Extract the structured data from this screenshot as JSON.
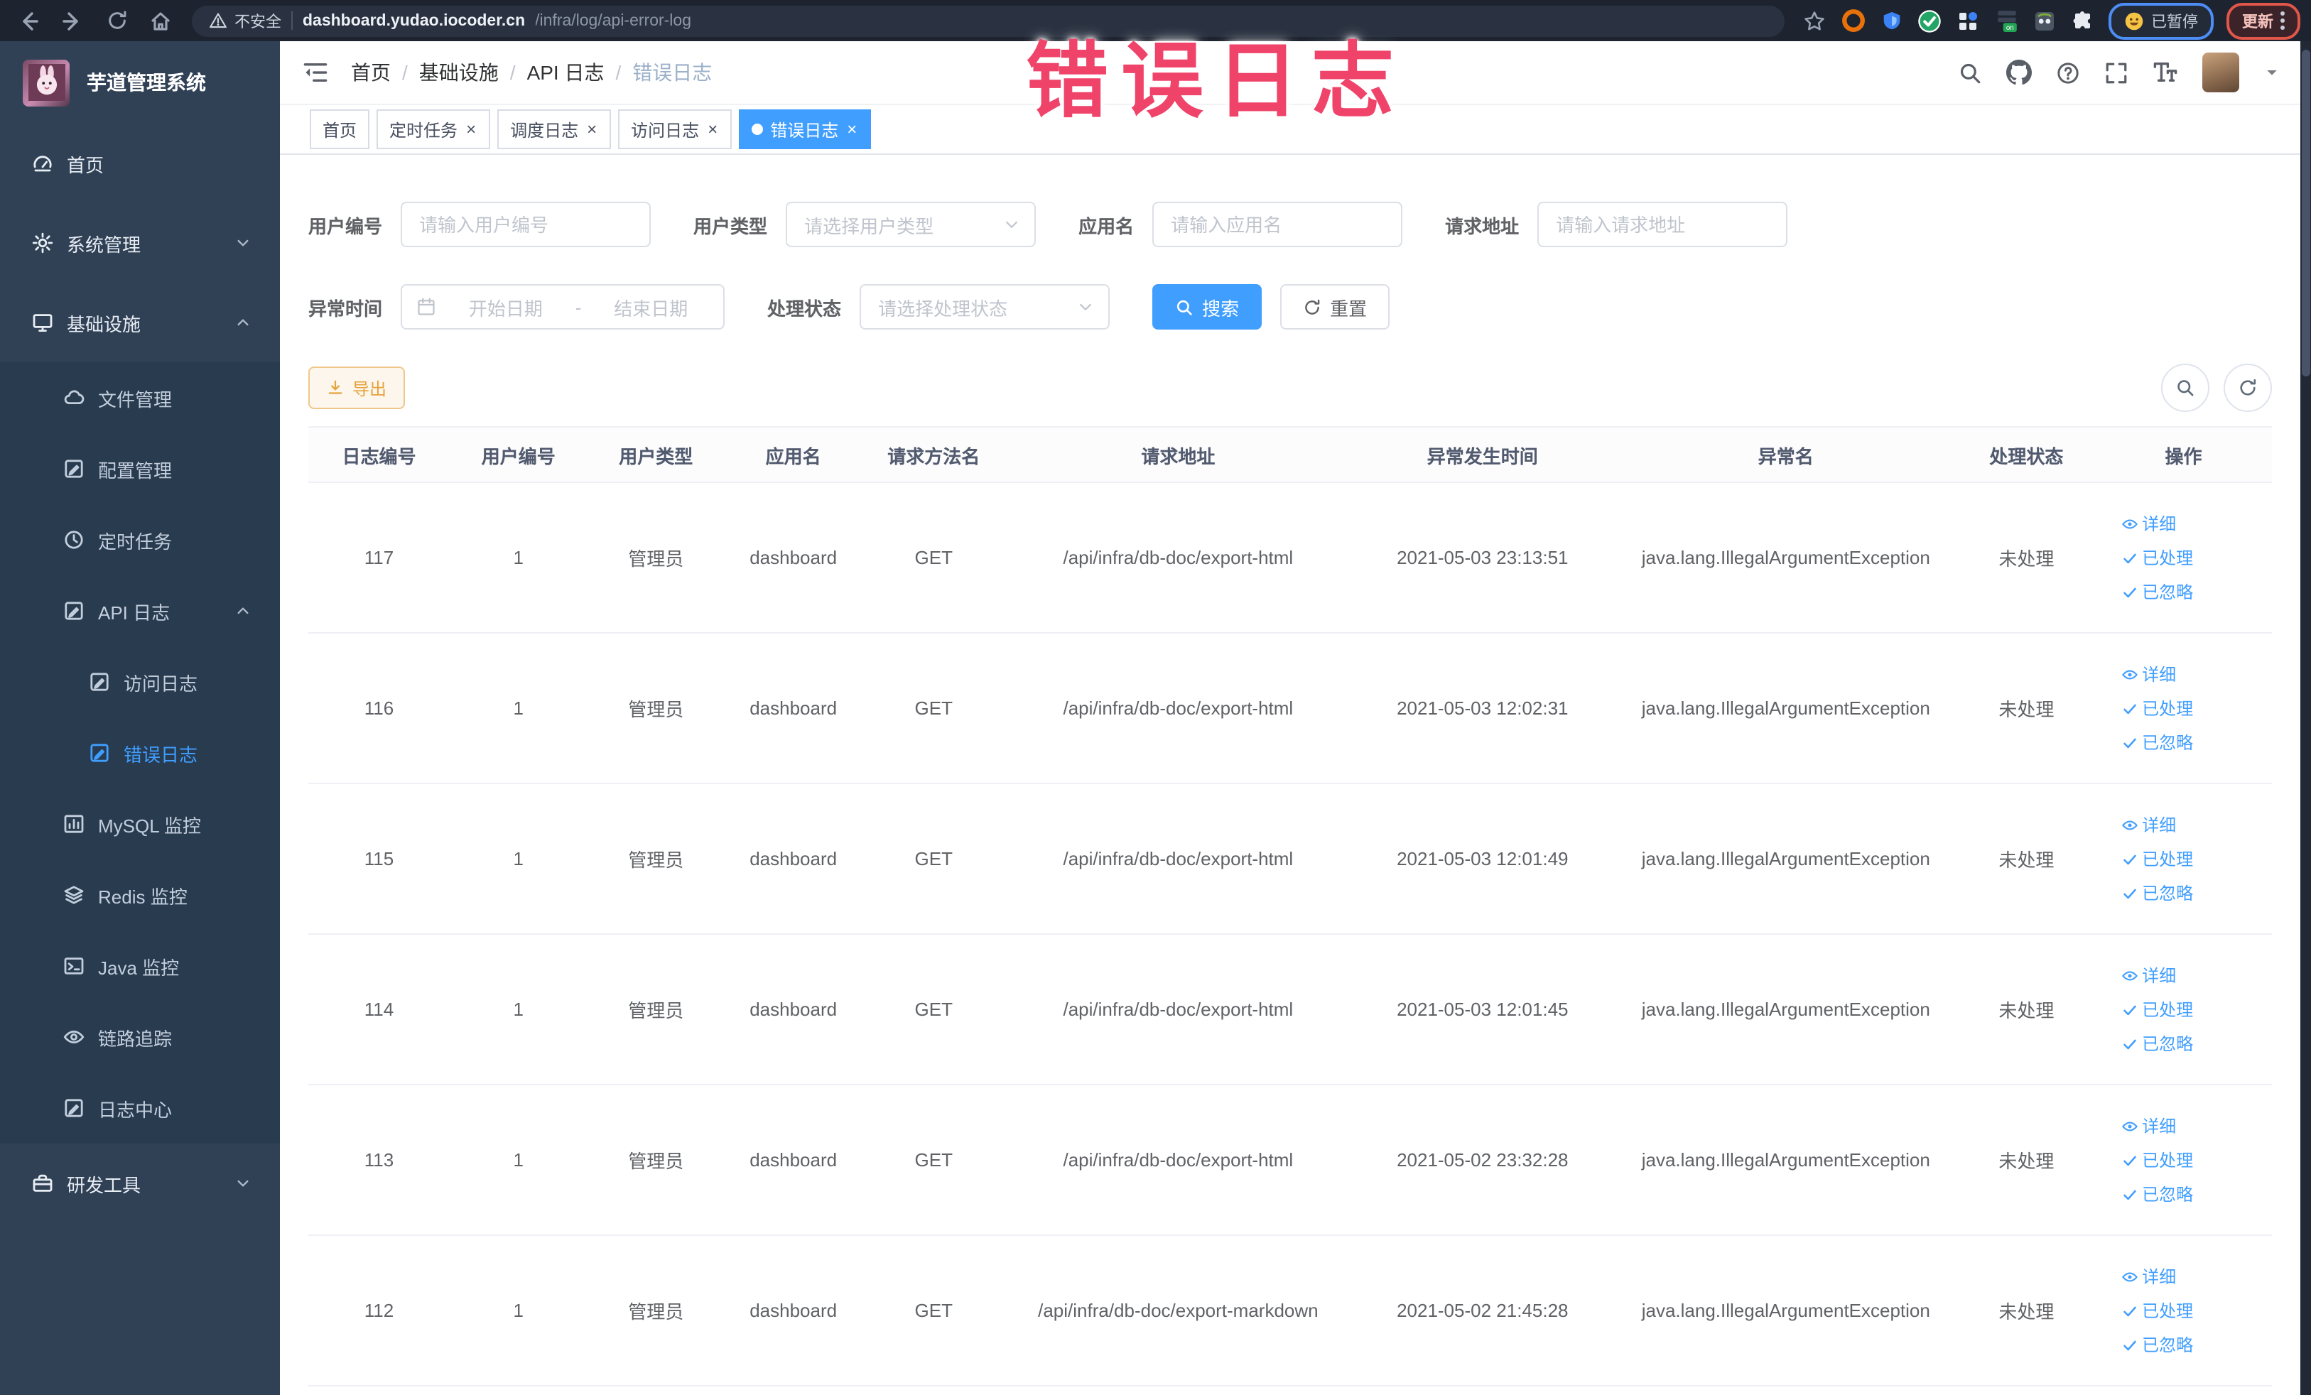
{
  "browser": {
    "security_label": "不安全",
    "url_host": "dashboard.yudao.iocoder.cn",
    "url_path": "/infra/log/api-error-log",
    "paused_badge": "已暂停",
    "update_label": "更新"
  },
  "watermark": "错误日志",
  "colors": {
    "primary": "#409eff",
    "sidebar_bg": "#304156",
    "sidebar_group_bg": "#283b4f",
    "warning": "#e6a23c",
    "watermark": "#f0436a",
    "browser_bar": "#1d2430"
  },
  "sidebar": {
    "title": "芋道管理系统",
    "items": [
      {
        "key": "home",
        "label": "首页",
        "icon": "gauge-icon",
        "depth": 0
      },
      {
        "key": "system",
        "label": "系统管理",
        "icon": "gear-icon",
        "depth": 0,
        "arrow": "down"
      },
      {
        "key": "infra",
        "label": "基础设施",
        "icon": "monitor-icon",
        "depth": 0,
        "arrow": "up"
      },
      {
        "key": "file",
        "label": "文件管理",
        "icon": "cloud-icon",
        "depth": 1,
        "group": true
      },
      {
        "key": "config",
        "label": "配置管理",
        "icon": "edit-icon",
        "depth": 1,
        "group": true
      },
      {
        "key": "job",
        "label": "定时任务",
        "icon": "clock-icon",
        "depth": 1,
        "group": true
      },
      {
        "key": "api-log",
        "label": "API 日志",
        "icon": "log-icon",
        "depth": 1,
        "arrow": "up",
        "group": true
      },
      {
        "key": "access-log",
        "label": "访问日志",
        "icon": "log-icon",
        "depth": 2,
        "group": true
      },
      {
        "key": "error-log",
        "label": "错误日志",
        "icon": "log-icon",
        "depth": 2,
        "active": true,
        "group": true
      },
      {
        "key": "mysql",
        "label": "MySQL 监控",
        "icon": "chart-icon",
        "depth": 1,
        "group": true
      },
      {
        "key": "redis",
        "label": "Redis 监控",
        "icon": "layers-icon",
        "depth": 1,
        "group": true
      },
      {
        "key": "java",
        "label": "Java 监控",
        "icon": "terminal-icon",
        "depth": 1,
        "group": true
      },
      {
        "key": "trace",
        "label": "链路追踪",
        "icon": "eye-icon",
        "depth": 1,
        "group": true
      },
      {
        "key": "log-center",
        "label": "日志中心",
        "icon": "log-icon",
        "depth": 1,
        "group": true
      },
      {
        "key": "dev-tools",
        "label": "研发工具",
        "icon": "toolbox-icon",
        "depth": 0,
        "arrow": "down"
      }
    ]
  },
  "navbar": {
    "breadcrumb": [
      "首页",
      "基础设施",
      "API 日志",
      "错误日志"
    ],
    "separator": "/"
  },
  "tags": [
    {
      "label": "首页",
      "closable": false,
      "active": false
    },
    {
      "label": "定时任务",
      "closable": true,
      "active": false
    },
    {
      "label": "调度日志",
      "closable": true,
      "active": false
    },
    {
      "label": "访问日志",
      "closable": true,
      "active": false
    },
    {
      "label": "错误日志",
      "closable": true,
      "active": true
    }
  ],
  "tag_close_glyph": "×",
  "filters": {
    "user_id": {
      "label": "用户编号",
      "placeholder": "请输入用户编号"
    },
    "user_type": {
      "label": "用户类型",
      "placeholder": "请选择用户类型"
    },
    "app_name": {
      "label": "应用名",
      "placeholder": "请输入应用名"
    },
    "request_url": {
      "label": "请求地址",
      "placeholder": "请输入请求地址"
    },
    "exception_time": {
      "label": "异常时间",
      "start_placeholder": "开始日期",
      "separator": "-",
      "end_placeholder": "结束日期"
    },
    "process_status": {
      "label": "处理状态",
      "placeholder": "请选择处理状态"
    },
    "search_label": "搜索",
    "reset_label": "重置"
  },
  "toolbar": {
    "export_label": "导出"
  },
  "table": {
    "headers": [
      "日志编号",
      "用户编号",
      "用户类型",
      "应用名",
      "请求方法名",
      "请求地址",
      "异常发生时间",
      "异常名",
      "处理状态",
      "操作"
    ],
    "actions": [
      "详细",
      "已处理",
      "已忽略"
    ],
    "rows": [
      {
        "id": "117",
        "user_id": "1",
        "user_type": "管理员",
        "app": "dashboard",
        "method": "GET",
        "url": "/api/infra/db-doc/export-html",
        "time": "2021-05-03 23:13:51",
        "exception": "java.lang.IllegalArgumentException",
        "status": "未处理"
      },
      {
        "id": "116",
        "user_id": "1",
        "user_type": "管理员",
        "app": "dashboard",
        "method": "GET",
        "url": "/api/infra/db-doc/export-html",
        "time": "2021-05-03 12:02:31",
        "exception": "java.lang.IllegalArgumentException",
        "status": "未处理"
      },
      {
        "id": "115",
        "user_id": "1",
        "user_type": "管理员",
        "app": "dashboard",
        "method": "GET",
        "url": "/api/infra/db-doc/export-html",
        "time": "2021-05-03 12:01:49",
        "exception": "java.lang.IllegalArgumentException",
        "status": "未处理"
      },
      {
        "id": "114",
        "user_id": "1",
        "user_type": "管理员",
        "app": "dashboard",
        "method": "GET",
        "url": "/api/infra/db-doc/export-html",
        "time": "2021-05-03 12:01:45",
        "exception": "java.lang.IllegalArgumentException",
        "status": "未处理"
      },
      {
        "id": "113",
        "user_id": "1",
        "user_type": "管理员",
        "app": "dashboard",
        "method": "GET",
        "url": "/api/infra/db-doc/export-html",
        "time": "2021-05-02 23:32:28",
        "exception": "java.lang.IllegalArgumentException",
        "status": "未处理"
      },
      {
        "id": "112",
        "user_id": "1",
        "user_type": "管理员",
        "app": "dashboard",
        "method": "GET",
        "url": "/api/infra/db-doc/export-markdown",
        "time": "2021-05-02 21:45:28",
        "exception": "java.lang.IllegalArgumentException",
        "status": "未处理"
      }
    ]
  }
}
